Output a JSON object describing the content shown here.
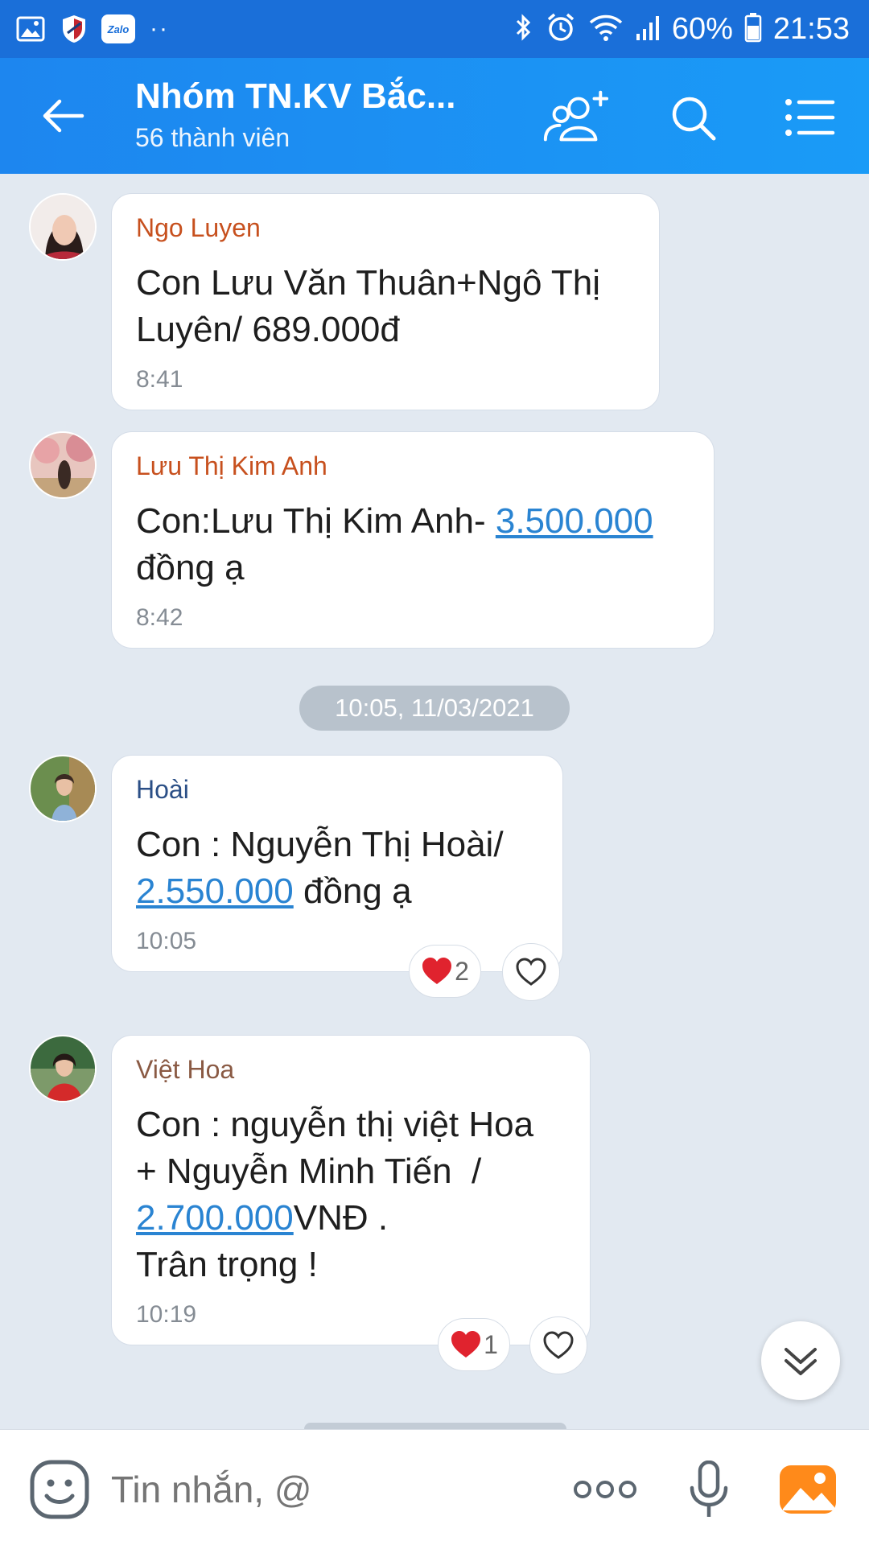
{
  "status_bar": {
    "time": "21:53",
    "battery": "60%",
    "app_badge": "Zalo",
    "overflow": "··"
  },
  "header": {
    "title": "Nhóm TN.KV Bắc...",
    "subtitle": "56 thành viên"
  },
  "messages": [
    {
      "sender": "Ngo Luyen",
      "sender_color": "#c7501e",
      "text": "Con Lưu Văn Thuân+Ngô Thị Luyên/ 689.000đ",
      "time": "8:41"
    },
    {
      "sender": "Lưu Thị Kim Anh",
      "sender_color": "#c7501e",
      "text_before": "Con:Lưu Thị Kim Anh- ",
      "link": "3.500.000",
      "text_after": " đồng ạ",
      "time": "8:42"
    },
    {
      "sender": "Hoài",
      "sender_color": "#2b4f86",
      "text_before": "Con : Nguyễn Thị Hoài/ ",
      "link": "2.550.000",
      "text_after": " đồng ạ",
      "time": "10:05",
      "reaction_count": "2"
    },
    {
      "sender": "Việt Hoa",
      "sender_color": "#8a5a44",
      "line1": "Con : nguyễn thị việt Hoa",
      "line2": "+ Nguyễn Minh Tiến  /",
      "link": "2.700.000",
      "link_suffix": "VNĐ .",
      "line4": "Trân trọng !",
      "time": "10:19",
      "reaction_count": "1"
    }
  ],
  "date_separator": "10:05, 11/03/2021",
  "input": {
    "placeholder": "Tin nhắn, @"
  },
  "colors": {
    "header_blue": "#1d86ef",
    "link": "#2a84d2",
    "heart": "#e0232e"
  },
  "icons": [
    "back-arrow-icon",
    "add-member-icon",
    "search-icon",
    "menu-icon",
    "heart-icon",
    "like-heart-icon",
    "scroll-down-icon",
    "emoji-icon",
    "more-icon",
    "microphone-icon",
    "image-icon"
  ]
}
